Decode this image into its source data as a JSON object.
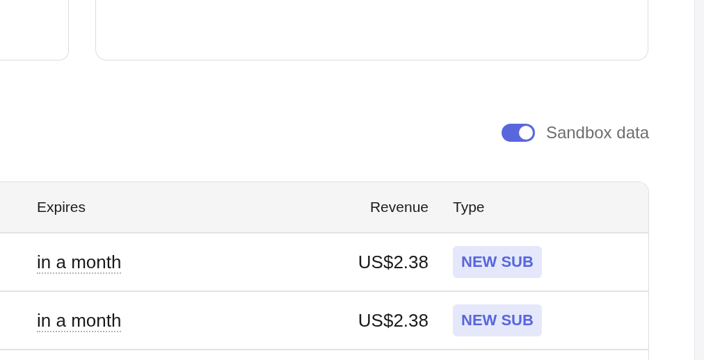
{
  "sandbox_toggle": {
    "label": "Sandbox data",
    "on": true
  },
  "table": {
    "columns": [
      "Expires",
      "Revenue",
      "Type"
    ],
    "rows": [
      {
        "expires": "in a month",
        "revenue": "US$2.38",
        "type": "NEW SUB"
      },
      {
        "expires": "in a month",
        "revenue": "US$2.38",
        "type": "NEW SUB"
      }
    ]
  }
}
